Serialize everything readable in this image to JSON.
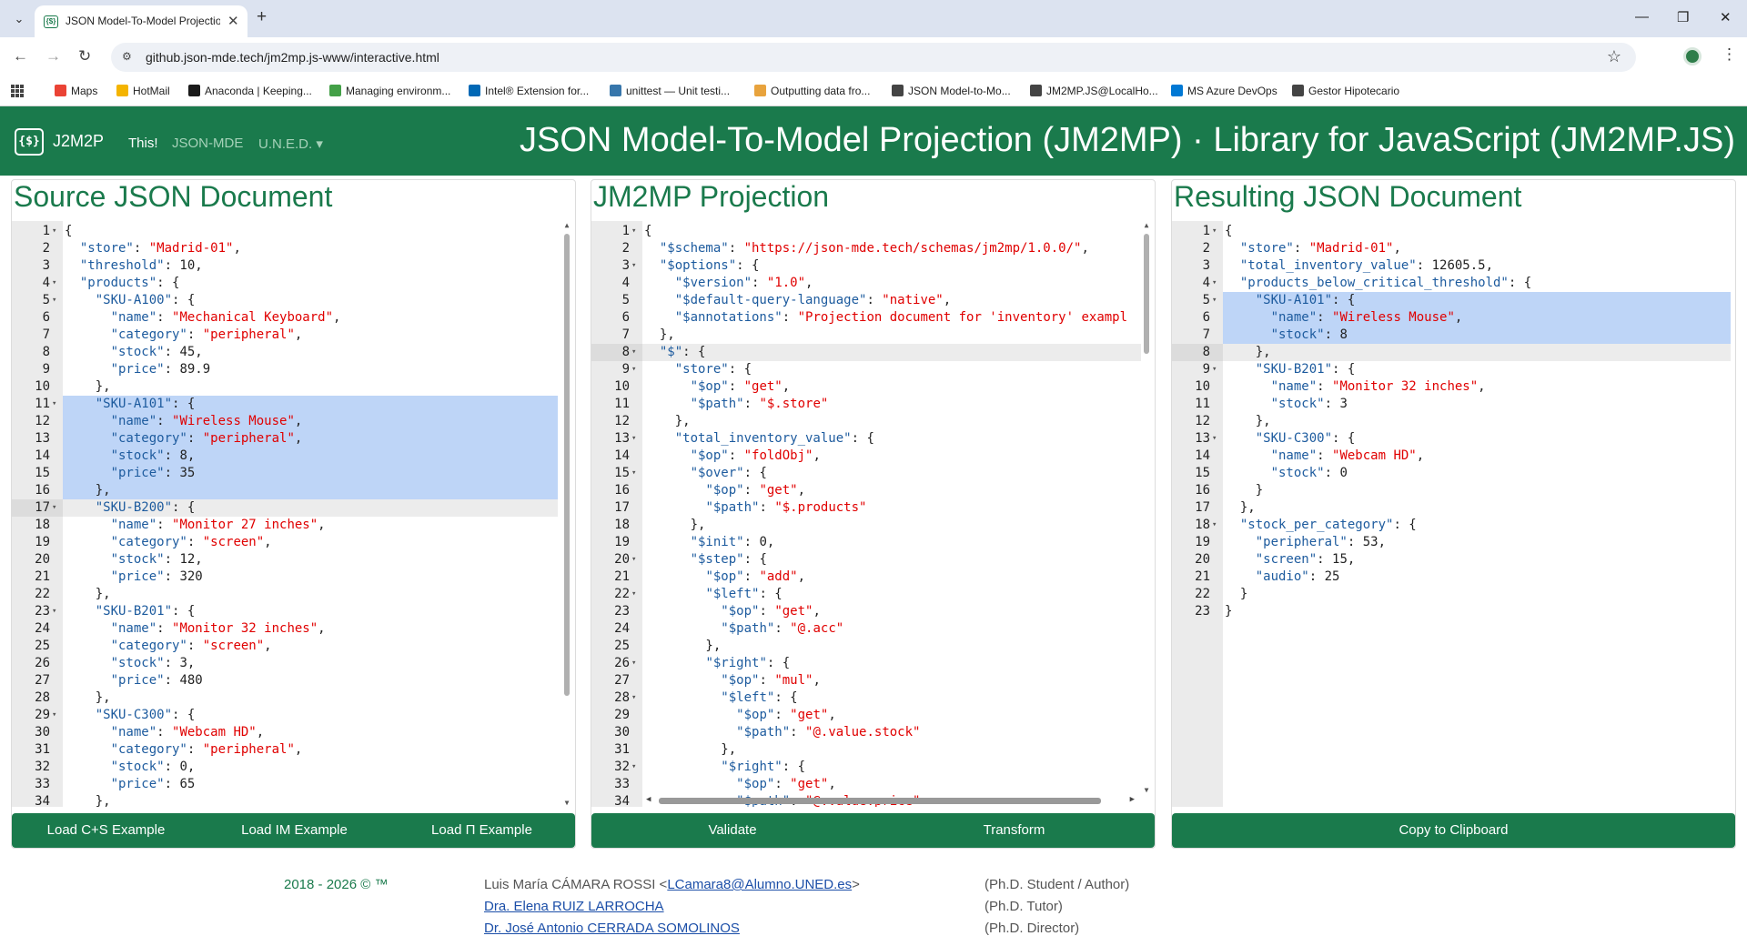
{
  "browser": {
    "tab_title": "JSON Model-To-Model Projection",
    "url": "github.json-mde.tech/jm2mp.js-www/interactive.html",
    "bookmarks": [
      {
        "label": "Maps",
        "color": "#ea4335"
      },
      {
        "label": "HotMail",
        "color": "#f4b400"
      },
      {
        "label": "Anaconda | Keeping...",
        "color": "#1a1a1a"
      },
      {
        "label": "Managing environm...",
        "color": "#43a047"
      },
      {
        "label": "Intel® Extension for...",
        "color": "#0068b5"
      },
      {
        "label": "unittest — Unit testi...",
        "color": "#3776ab"
      },
      {
        "label": "Outputting data fro...",
        "color": "#e8a33d"
      },
      {
        "label": "JSON Model-to-Mo...",
        "color": "#444444"
      },
      {
        "label": "JM2MP.JS@LocalHo...",
        "color": "#444444"
      },
      {
        "label": "MS Azure DevOps",
        "color": "#0078d4"
      },
      {
        "label": "Gestor Hipotecario",
        "color": "#444444"
      }
    ]
  },
  "header": {
    "logo_text": "{$}",
    "brand": "J2M2P",
    "nav": [
      {
        "label": "This!",
        "active": true
      },
      {
        "label": "JSON-MDE",
        "active": false
      },
      {
        "label": "U.N.E.D. ▾",
        "active": false
      }
    ],
    "title": "JSON Model-To-Model Projection (JM2MP) · Library for JavaScript (JM2MP.JS)",
    "color": "#1a7a4c"
  },
  "panels": {
    "source": {
      "title": "Source JSON Document",
      "buttons": [
        "Load C+S Example",
        "Load IM Example",
        "Load Π Example"
      ],
      "lines": [
        "{",
        "  \"store\": \"Madrid-01\",",
        "  \"threshold\": 10,",
        "  \"products\": {",
        "    \"SKU-A100\": {",
        "      \"name\": \"Mechanical Keyboard\",",
        "      \"category\": \"peripheral\",",
        "      \"stock\": 45,",
        "      \"price\": 89.9",
        "    },",
        "    \"SKU-A101\": {",
        "      \"name\": \"Wireless Mouse\",",
        "      \"category\": \"peripheral\",",
        "      \"stock\": 8,",
        "      \"price\": 35",
        "    },",
        "    \"SKU-B200\": {",
        "      \"name\": \"Monitor 27 inches\",",
        "      \"category\": \"screen\",",
        "      \"stock\": 12,",
        "      \"price\": 320",
        "    },",
        "    \"SKU-B201\": {",
        "      \"name\": \"Monitor 32 inches\",",
        "      \"category\": \"screen\",",
        "      \"stock\": 3,",
        "      \"price\": 480",
        "    },",
        "    \"SKU-C300\": {",
        "      \"name\": \"Webcam HD\",",
        "      \"category\": \"peripheral\",",
        "      \"stock\": 0,",
        "      \"price\": 65",
        "    },"
      ]
    },
    "projection": {
      "title": "JM2MP Projection",
      "buttons": [
        "Validate",
        "Transform"
      ],
      "lines": [
        "{",
        "  \"$schema\": \"https://json-mde.tech/schemas/jm2mp/1.0.0/\",",
        "  \"$options\": {",
        "    \"$version\": \"1.0\",",
        "    \"$default-query-language\": \"native\",",
        "    \"$annotations\": \"Projection document for 'inventory' exampl",
        "  },",
        "  \"$\": {",
        "    \"store\": {",
        "      \"$op\": \"get\",",
        "      \"$path\": \"$.store\"",
        "    },",
        "    \"total_inventory_value\": {",
        "      \"$op\": \"foldObj\",",
        "      \"$over\": {",
        "        \"$op\": \"get\",",
        "        \"$path\": \"$.products\"",
        "      },",
        "      \"$init\": 0,",
        "      \"$step\": {",
        "        \"$op\": \"add\",",
        "        \"$left\": {",
        "          \"$op\": \"get\",",
        "          \"$path\": \"@.acc\"",
        "        },",
        "        \"$right\": {",
        "          \"$op\": \"mul\",",
        "          \"$left\": {",
        "            \"$op\": \"get\",",
        "            \"$path\": \"@.value.stock\"",
        "          },",
        "          \"$right\": {",
        "            \"$op\": \"get\",",
        "            \"$path\": \"@.value.price\""
      ]
    },
    "result": {
      "title": "Resulting JSON Document",
      "buttons": [
        "Copy to Clipboard"
      ],
      "lines": [
        "{",
        "  \"store\": \"Madrid-01\",",
        "  \"total_inventory_value\": 12605.5,",
        "  \"products_below_critical_threshold\": {",
        "    \"SKU-A101\": {",
        "      \"name\": \"Wireless Mouse\",",
        "      \"stock\": 8",
        "    },",
        "    \"SKU-B201\": {",
        "      \"name\": \"Monitor 32 inches\",",
        "      \"stock\": 3",
        "    },",
        "    \"SKU-C300\": {",
        "      \"name\": \"Webcam HD\",",
        "      \"stock\": 0",
        "    }",
        "  },",
        "  \"stock_per_category\": {",
        "    \"peripheral\": 53,",
        "    \"screen\": 15,",
        "    \"audio\": 25",
        "  }",
        "}"
      ]
    }
  },
  "footer": {
    "years": "2018 - 2026 © ™",
    "author_name": "Luis María CÁMARA ROSSI <",
    "author_email": "LCamara8@Alumno.UNED.es",
    "author_close": ">",
    "tutor": "Dra. Elena RUIZ LARROCHA",
    "director": "Dr. José Antonio CERRADA SOMOLINOS",
    "role_author": "(Ph.D. Student / Author)",
    "role_tutor": "(Ph.D. Tutor)",
    "role_director": "(Ph.D. Director)"
  }
}
